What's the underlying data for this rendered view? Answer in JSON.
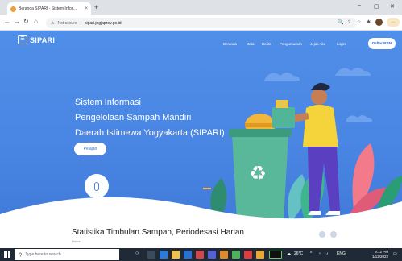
{
  "browser": {
    "tab_title": "Beranda SIPARI - Sistem Infor…",
    "tab_close": "×",
    "new_tab": "+",
    "minimize": "−",
    "maximize": "▢",
    "close": "✕",
    "security_label": "Not secure",
    "url": "sipari.jogjaprov.go.id",
    "menu_label": "…"
  },
  "site": {
    "logo_text": "SIPARI",
    "nav": [
      "Beranda",
      "Data",
      "Berita",
      "Pengumuman",
      "Jejak Aku",
      "Login"
    ],
    "register_button": "Daftar BSM",
    "hero_lines": [
      "Sistem Informasi",
      "Pengelolaan Sampah Mandiri",
      "Daerah Istimewa Yogyakarta (SIPARI)"
    ],
    "hero_button": "Pelajari",
    "section_title": "Statistika Timbulan Sampah, Periodesasi Harian",
    "section_subtitle": "Harian"
  },
  "taskbar": {
    "search_placeholder": "Type here to search",
    "weather": "26°C",
    "time": "9:12 PM",
    "date": "1/12/2022",
    "lang": "ENG"
  },
  "colors": {
    "hero": "#4a86e3",
    "accent": "#2f6bd1",
    "taskbar": "#1f2a36"
  }
}
